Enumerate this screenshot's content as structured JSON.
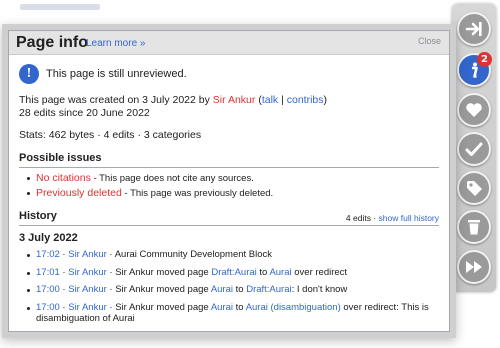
{
  "dialog": {
    "title": "Page info",
    "learn_more": "Learn more »",
    "close": "Close"
  },
  "notice": {
    "icon": "!",
    "text": "This page is still unreviewed."
  },
  "created": {
    "prefix": "This page was created on 3 July 2022 by ",
    "user": "Sir Ankur",
    "open": " (",
    "talk": "talk",
    "sep": " | ",
    "contribs": "contribs",
    "close": ")",
    "line2": "28 edits since 20 June 2022"
  },
  "stats": "Stats: 462 bytes · 4 edits · 3 categories",
  "issues": {
    "heading": "Possible issues",
    "items": [
      {
        "label": "No citations",
        "desc": " - This page does not cite any sources."
      },
      {
        "label": "Previously deleted",
        "desc": " - This page was previously deleted."
      }
    ]
  },
  "history": {
    "heading": "History",
    "edits": "4 edits",
    "dot": " · ",
    "show_full": "show full history",
    "date": "3 July 2022",
    "entries": [
      {
        "time": "17:02",
        "sep": " · ",
        "user": "Sir Ankur",
        "p1": " · Aurai Community Development Block",
        "l1": "",
        "p2": "",
        "l2": "",
        "p3": ""
      },
      {
        "time": "17:01",
        "sep": " · ",
        "user": "Sir Ankur",
        "p1": " · Sir Ankur moved page ",
        "l1": "Draft:Aurai",
        "p2": " to ",
        "l2": "Aurai",
        "p3": " over redirect"
      },
      {
        "time": "17:00",
        "sep": " · ",
        "user": "Sir Ankur",
        "p1": " · Sir Ankur moved page ",
        "l1": "Aurai",
        "p2": " to ",
        "l2": "Draft:Aurai",
        "p3": ": I don't know"
      },
      {
        "time": "17:00",
        "sep": " · ",
        "user": "Sir Ankur",
        "p1": " · Sir Ankur moved page ",
        "l1": "Aurai",
        "p2": " to ",
        "l2": "Aurai (disambiguation)",
        "p3": " over redirect: This is disambiguation of Aurai"
      }
    ]
  },
  "toolbar": {
    "badge": "2",
    "icons": [
      "collapse-arrow-icon",
      "info-icon",
      "heart-icon",
      "checkmark-icon",
      "tag-icon",
      "trash-icon",
      "fast-forward-icon"
    ]
  },
  "colors": {
    "link": "#3366cc",
    "red_link": "#d33333",
    "toolbar_btn": "#9a9a9a"
  }
}
